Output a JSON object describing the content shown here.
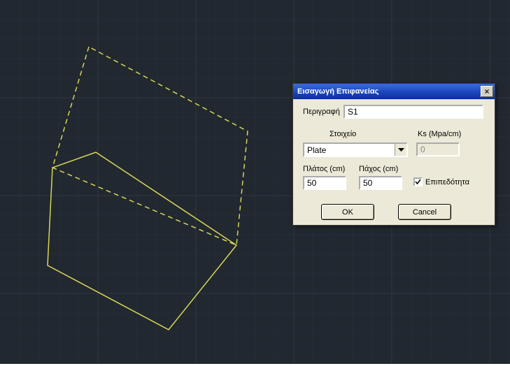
{
  "dialog": {
    "title": "Εισαγωγή Επιφανείας",
    "description_label": "Περιγραφή",
    "description_value": "S1",
    "element_label": "Στοιχείο",
    "element_value": "Plate",
    "ks_label": "Ks (Mpa/cm)",
    "ks_value": "0",
    "width_label": "Πλάτος (cm)",
    "width_value": "50",
    "thickness_label": "Πάχος (cm)",
    "thickness_value": "50",
    "flatness_label": "Επιπεδότητα",
    "ok_label": "OK",
    "cancel_label": "Cancel"
  },
  "colors": {
    "canvas_bg": "#212830",
    "shape_stroke": "#d6d657",
    "dialog_bg": "#ece9d8",
    "titlebar_gradient_top": "#3a6dd8",
    "titlebar_gradient_bottom": "#0a2f9c"
  }
}
